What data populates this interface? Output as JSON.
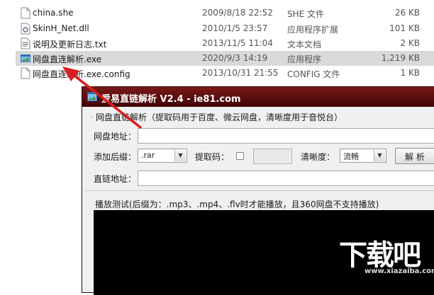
{
  "files": [
    {
      "name": "china.she",
      "date": "2009/8/18 22:52",
      "type": "SHE 文件",
      "size": "26 KB",
      "icon": "document-icon"
    },
    {
      "name": "SkinH_Net.dll",
      "date": "2010/1/5 23:57",
      "type": "应用程序扩展",
      "size": "101 KB",
      "icon": "dll-gear-icon"
    },
    {
      "name": "说明及更新日志.txt",
      "date": "2013/11/5 11:04",
      "type": "文本文档",
      "size": "2 KB",
      "icon": "text-file-icon"
    },
    {
      "name": "网盘直连解析.exe",
      "date": "2020/9/3 14:19",
      "type": "应用程序",
      "size": "1,219 KB",
      "icon": "app-exe-icon"
    },
    {
      "name": "网盘直连解析.exe.config",
      "date": "2013/10/31 21:55",
      "type": "CONFIG 文件",
      "size": "1 KB",
      "icon": "config-file-icon"
    }
  ],
  "app": {
    "title": "爱易直链解析 V2.4 - ie81.com",
    "group_title": "网盘直链解析（提取码用于百度、微云网盘，清晰度用于音悦台）",
    "netdisk_label": "网盘地址：",
    "suffix_label": "添加后缀：",
    "suffix_value": ".rar",
    "code_label": "提取码：",
    "clarity_label": "清晰度：",
    "clarity_value": "流畅",
    "parse_button": "解 析",
    "direct_label": "直链地址：",
    "playback_title": "播放测试(后缀为：.mp3、.mp4、.flv时才能播放，且360网盘不支持播放)"
  },
  "watermark": {
    "main": "下载吧",
    "sub": "www.xiazaiba.com"
  },
  "colors": {
    "titlebar": "#5a0c0c",
    "selection": "#d9d9d9",
    "annotation_arrow": "#d81e1e"
  }
}
